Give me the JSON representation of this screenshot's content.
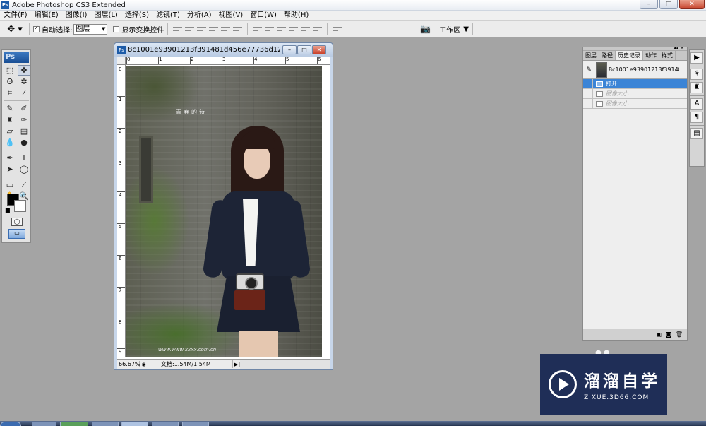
{
  "app": {
    "title": "Adobe Photoshop CS3 Extended",
    "logo": "Ps"
  },
  "menubar": {
    "items": [
      "文件(F)",
      "编辑(E)",
      "图像(I)",
      "图层(L)",
      "选择(S)",
      "滤镜(T)",
      "分析(A)",
      "视图(V)",
      "窗口(W)",
      "帮助(H)"
    ]
  },
  "options": {
    "auto_select_label": "自动选择:",
    "auto_select_value": "图层",
    "show_transform_label": "显示变换控件",
    "workspace_label": "工作区"
  },
  "document": {
    "title": "8c1001e93901213f391481d456e77736d12f2e9597.j...",
    "zoom": "66.67%",
    "doc_info": "文档:1.54M/1.54M",
    "ruler_top": [
      "0",
      "1",
      "2",
      "3",
      "4",
      "5",
      "6"
    ],
    "ruler_left": [
      "0",
      "1",
      "2",
      "3",
      "4",
      "5",
      "6",
      "7",
      "8",
      "9"
    ],
    "photo_text": "青春的诗",
    "photo_watermark": "www.www.xxxx.com.cn"
  },
  "history_panel": {
    "tabs": [
      "图层",
      "路径",
      "历史记录",
      "动作",
      "样式"
    ],
    "snapshot_name": "8c1001e93901213f39148...",
    "items": [
      {
        "label": "打开",
        "state": "active"
      },
      {
        "label": "图像大小",
        "state": "undone"
      },
      {
        "label": "图像大小",
        "state": "undone"
      }
    ]
  },
  "watermark": {
    "cn": "溜溜自学",
    "en": "ZIXUE.3D66.COM"
  }
}
